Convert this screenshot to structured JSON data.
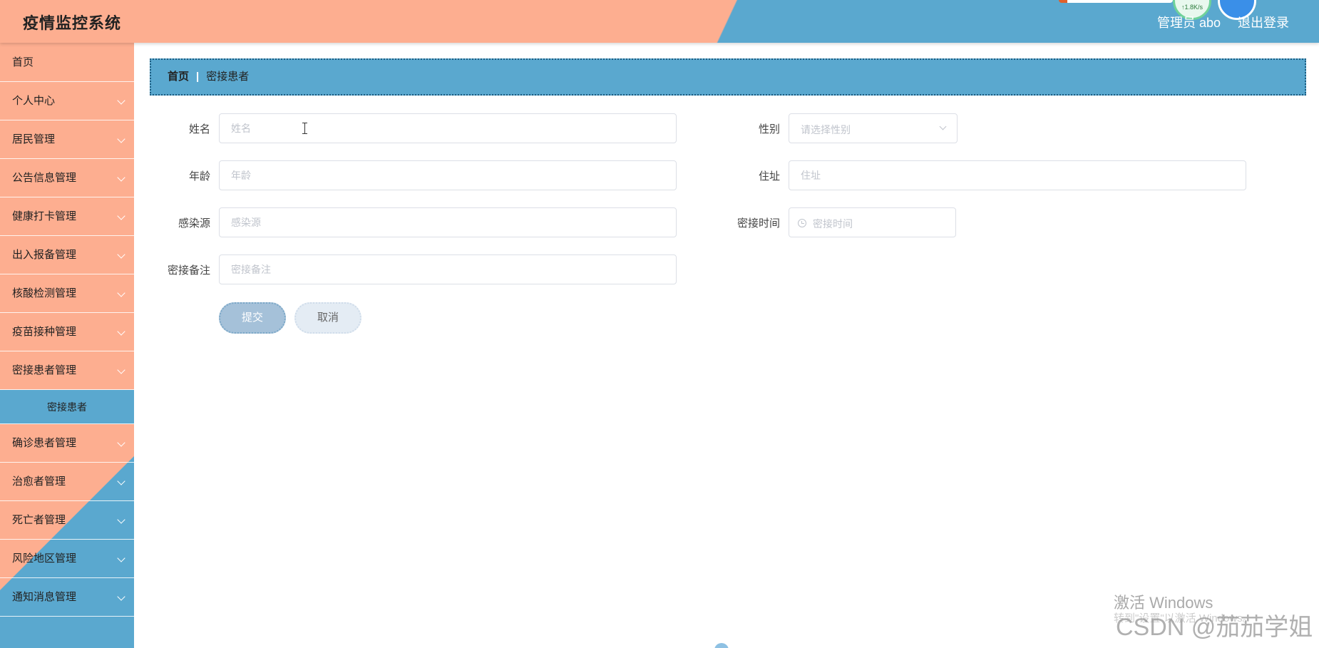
{
  "header": {
    "title": "疫情监控系统",
    "user_label": "管理员 abo",
    "logout_label": "退出登录",
    "widget_speed": "↑1.8K/s",
    "colors": {
      "left": "#fdae90",
      "right": "#5aa8cf"
    }
  },
  "sidebar": {
    "items": [
      {
        "label": "首页"
      },
      {
        "label": "个人中心"
      },
      {
        "label": "居民管理"
      },
      {
        "label": "公告信息管理"
      },
      {
        "label": "健康打卡管理"
      },
      {
        "label": "出入报备管理"
      },
      {
        "label": "核酸检测管理"
      },
      {
        "label": "疫苗接种管理"
      },
      {
        "label": "密接患者管理"
      },
      {
        "label": "确诊患者管理"
      },
      {
        "label": "治愈者管理"
      },
      {
        "label": "死亡者管理"
      },
      {
        "label": "风险地区管理"
      },
      {
        "label": "通知消息管理"
      }
    ],
    "active_sub": "密接患者",
    "colors": {
      "primary": "#fdae90",
      "accent": "#5aa8cf"
    }
  },
  "breadcrumb": {
    "home": "首页",
    "separator": "|",
    "current": "密接患者"
  },
  "form": {
    "name": {
      "label": "姓名",
      "placeholder": "姓名",
      "value": ""
    },
    "gender": {
      "label": "性别",
      "placeholder": "请选择性别"
    },
    "age": {
      "label": "年龄",
      "placeholder": "年龄",
      "value": ""
    },
    "address": {
      "label": "住址",
      "placeholder": "住址",
      "value": ""
    },
    "source": {
      "label": "感染源",
      "placeholder": "感染源",
      "value": ""
    },
    "contact_time": {
      "label": "密接时间",
      "placeholder": "密接时间"
    },
    "remark": {
      "label": "密接备注",
      "placeholder": "密接备注",
      "value": ""
    },
    "submit_label": "提交",
    "cancel_label": "取消"
  },
  "watermark": {
    "line1": "激活 Windows",
    "line2": "转到\"设置\"以激活 Windows。",
    "csdn": "CSDN @茄茄学姐"
  }
}
